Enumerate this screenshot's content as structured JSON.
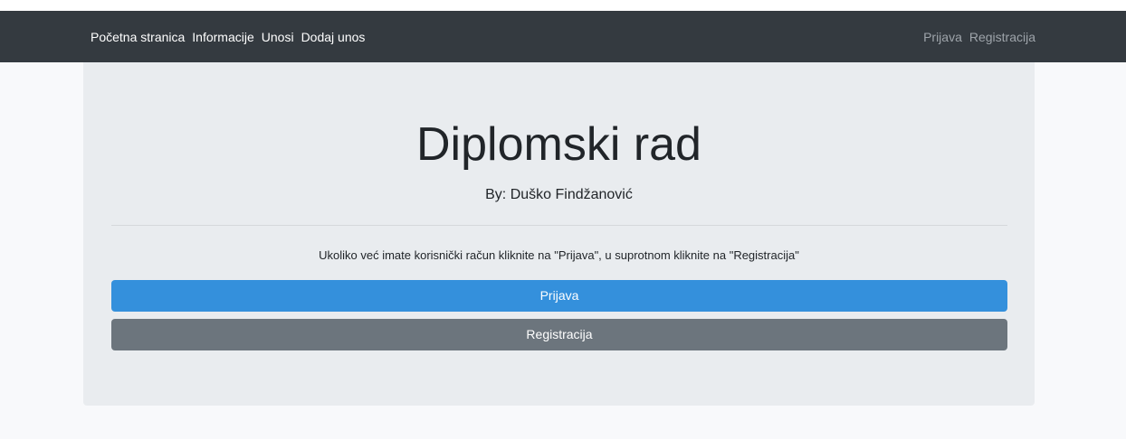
{
  "navbar": {
    "left_links": [
      {
        "label": "Početna stranica"
      },
      {
        "label": "Informacije"
      },
      {
        "label": "Unosi"
      },
      {
        "label": "Dodaj unos"
      }
    ],
    "right_links": [
      {
        "label": "Prijava"
      },
      {
        "label": "Registracija"
      }
    ]
  },
  "jumbotron": {
    "title": "Diplomski rad",
    "byline": "By: Duško Findžanović",
    "lead": "Ukoliko već imate korisnički račun kliknite na \"Prijava\", u suprotnom kliknite na \"Registracija\"",
    "login_button": "Prijava",
    "register_button": "Registracija"
  },
  "colors": {
    "navbar_bg": "#343a40",
    "jumbotron_bg": "#e9ecef",
    "primary": "#3490dc",
    "secondary": "#6c757d"
  }
}
